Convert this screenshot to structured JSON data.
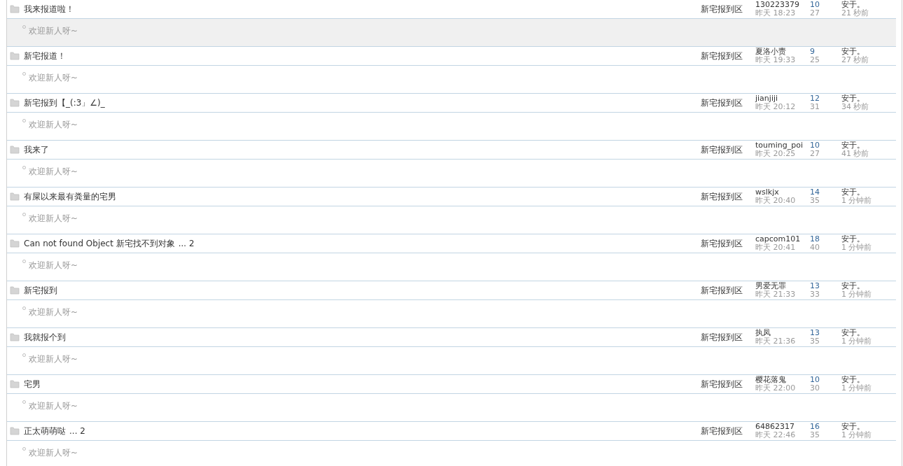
{
  "threads": [
    {
      "title": "我来报道啦！",
      "forum": "新宅报到区",
      "author": "130223379",
      "posted": "昨天 18:23",
      "replies": "10",
      "views": "27",
      "last_poster": "安于。",
      "last_time": "21 秒前",
      "excerpt": "欢迎新人呀~",
      "highlighted": true
    },
    {
      "title": "新宅报道！",
      "forum": "新宅报到区",
      "author": "夏洛小责",
      "posted": "昨天 19:33",
      "replies": "9",
      "views": "25",
      "last_poster": "安于。",
      "last_time": "27 秒前",
      "excerpt": "欢迎新人呀~",
      "highlighted": false
    },
    {
      "title": "新宅报到【_(:3」∠)_",
      "forum": "新宅报到区",
      "author": "jianjiji",
      "posted": "昨天 20:12",
      "replies": "12",
      "views": "31",
      "last_poster": "安于。",
      "last_time": "34 秒前",
      "excerpt": "欢迎新人呀~",
      "highlighted": false
    },
    {
      "title": "我来了",
      "forum": "新宅报到区",
      "author": "touming_poi",
      "posted": "昨天 20:25",
      "replies": "10",
      "views": "27",
      "last_poster": "安于。",
      "last_time": "41 秒前",
      "excerpt": "欢迎新人呀~",
      "highlighted": false
    },
    {
      "title": "有屎以来最有粪量的宅男",
      "forum": "新宅报到区",
      "author": "wslkjx",
      "posted": "昨天 20:40",
      "replies": "14",
      "views": "35",
      "last_poster": "安于。",
      "last_time": "1 分钟前",
      "excerpt": "欢迎新人呀~",
      "highlighted": false
    },
    {
      "title": "Can not found Object 新宅找不到对象",
      "pages": "... 2",
      "forum": "新宅报到区",
      "author": "capcom101",
      "posted": "昨天 20:41",
      "replies": "18",
      "views": "40",
      "last_poster": "安于。",
      "last_time": "1 分钟前",
      "excerpt": "欢迎新人呀~",
      "highlighted": false
    },
    {
      "title": "新宅报到",
      "forum": "新宅报到区",
      "author": "男爱无罪",
      "posted": "昨天 21:33",
      "replies": "13",
      "views": "33",
      "last_poster": "安于。",
      "last_time": "1 分钟前",
      "excerpt": "欢迎新人呀~",
      "highlighted": false
    },
    {
      "title": "我就报个到",
      "forum": "新宅报到区",
      "author": "执凤",
      "posted": "昨天 21:36",
      "replies": "13",
      "views": "35",
      "last_poster": "安于。",
      "last_time": "1 分钟前",
      "excerpt": "欢迎新人呀~",
      "highlighted": false
    },
    {
      "title": "宅男",
      "forum": "新宅报到区",
      "author": "樱花落鬼",
      "posted": "昨天 22:00",
      "replies": "10",
      "views": "30",
      "last_poster": "安于。",
      "last_time": "1 分钟前",
      "excerpt": "欢迎新人呀~",
      "highlighted": false
    },
    {
      "title": "正太萌萌哒",
      "pages": "... 2",
      "forum": "新宅报到区",
      "author": "64862317",
      "posted": "昨天 22:46",
      "replies": "16",
      "views": "35",
      "last_poster": "安于。",
      "last_time": "1 分钟前",
      "excerpt": "欢迎新人呀~",
      "highlighted": false
    }
  ]
}
